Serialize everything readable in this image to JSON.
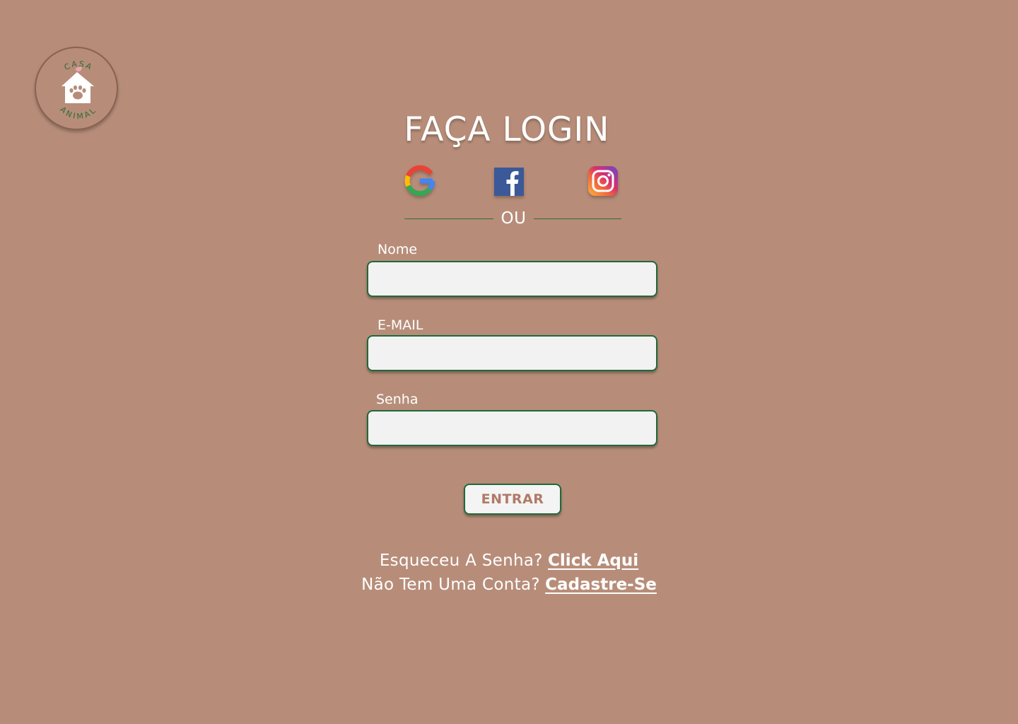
{
  "logo": {
    "top_text": "CASA",
    "bottom_text": "ANIMAL"
  },
  "title": "FAÇA LOGIN",
  "social": [
    {
      "icon": "google-icon",
      "name": "Google"
    },
    {
      "icon": "facebook-icon",
      "name": "Facebook"
    },
    {
      "icon": "instagram-icon",
      "name": "Instagram"
    }
  ],
  "divider_text": "OU",
  "form": {
    "name_label": "Nome",
    "name_value": "",
    "email_label": "E-MAIL",
    "email_value": "",
    "password_label": "Senha",
    "password_value": "",
    "submit_label": "ENTRAR"
  },
  "footer": {
    "forgot_prefix": "Esqueceu A Senha?",
    "forgot_link": "Click Aqui",
    "signup_prefix": "Não Tem Uma Conta?",
    "signup_link": "Cadastre-Se"
  },
  "colors": {
    "background": "#b78d79",
    "accent_green": "#1f6a3b",
    "input_bg": "#f2f2f2",
    "button_text": "#b07b67"
  }
}
